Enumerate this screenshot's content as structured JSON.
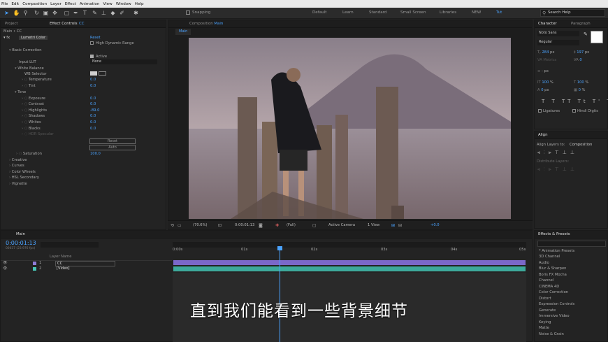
{
  "menu": [
    "File",
    "Edit",
    "Composition",
    "Layer",
    "Effect",
    "Animation",
    "View",
    "Window",
    "Help"
  ],
  "toolbar": {
    "snapping": "Snapping",
    "search_placeholder": "Search Help"
  },
  "workspaces": [
    {
      "label": "Default",
      "active": false
    },
    {
      "label": "Learn",
      "active": false
    },
    {
      "label": "Standard",
      "active": false
    },
    {
      "label": "Small Screen",
      "active": false
    },
    {
      "label": "Libraries",
      "active": false
    },
    {
      "label": "NEW",
      "active": false
    },
    {
      "label": "Tut",
      "active": true
    }
  ],
  "left_panel": {
    "tab_project": "Project",
    "tab_effect": "Effect Controls",
    "tab_effect_layer": "CC",
    "breadcrumb": "Main • CC",
    "effect_name": "Lumetri Color",
    "reset": "Reset",
    "hdr": "High Dynamic Range",
    "basic": "Basic Correction",
    "active": "Active",
    "input_lut": "Input LUT",
    "input_lut_value": "None",
    "white_balance": "White Balance",
    "wb_selector": "WB Selector",
    "temperature": "Temperature",
    "temperature_value": "0.0",
    "tint": "Tint",
    "tint_value": "0.0",
    "tone": "Tone",
    "exposure": "Exposure",
    "exposure_value": "0.0",
    "contrast": "Contrast",
    "contrast_value": "0.0",
    "highlights": "Highlights",
    "highlights_value": "-89.0",
    "shadows": "Shadows",
    "shadows_value": "0.0",
    "whites": "Whites",
    "whites_value": "0.0",
    "blacks": "Blacks",
    "blacks_value": "0.0",
    "hdr_specular": "HDR Specular",
    "reset_btn": "Reset",
    "auto_btn": "Auto",
    "saturation": "Saturation",
    "saturation_value": "100.0",
    "sections": [
      "Creative",
      "Curves",
      "Color Wheels",
      "HSL Secondary",
      "Vignette"
    ]
  },
  "comp_panel": {
    "tab_label": "Composition",
    "tab_comp": "Main",
    "sub_tab": "Main",
    "zoom": "(70.6%)",
    "timecode": "0:00:01:13",
    "resolution": "(Full)",
    "camera": "Active Camera",
    "view": "1 View",
    "exposure": "+0.0"
  },
  "right_panel": {
    "character_tab": "Character",
    "paragraph_tab": "Paragraph",
    "font": "Noto Sans",
    "style": "Regular",
    "size": "284",
    "size_unit": "px",
    "leading": "197",
    "leading_unit": "px",
    "kerning": "Metrics",
    "tracking": "0",
    "stroke": "- px",
    "vscale": "100",
    "vscale_unit": "%",
    "hscale": "100",
    "hscale_unit": "%",
    "baseline": "0",
    "baseline_unit": "px",
    "tsume": "0",
    "tsume_unit": "%",
    "ligatures": "Ligatures",
    "hindi": "Hindi Digits",
    "align_tab": "Align",
    "align_to_label": "Align Layers to:",
    "align_to_value": "Composition",
    "distribute": "Distribute Layers:",
    "effects_tab": "Effects & Presets",
    "effects": [
      "* Animation Presets",
      "3D Channel",
      "Audio",
      "Blur & Sharpen",
      "Boris FX Mocha",
      "Channel",
      "CINEMA 4D",
      "Color Correction",
      "Distort",
      "Expression Controls",
      "Generate",
      "Immersive Video",
      "Keying",
      "Matte",
      "Noise & Grain"
    ]
  },
  "timeline": {
    "tab": "Main",
    "timecode": "0:00:01:13",
    "frames": "00037 (23.976 fps)",
    "col_layer": "Layer Name",
    "ruler": [
      "0:00s",
      "01s",
      "02s",
      "03s",
      "04s",
      "05s"
    ],
    "layers": [
      {
        "num": "1",
        "name": "CC",
        "color": "#8f7bd6"
      },
      {
        "num": "2",
        "name": "[Video]",
        "color": "#47c6b6"
      }
    ]
  },
  "subtitle": "直到我们能看到一些背景细节",
  "colors": {
    "accent": "#4aa3ff",
    "layer1_bar": "#7b68c9",
    "layer2_bar": "#3da99b"
  }
}
